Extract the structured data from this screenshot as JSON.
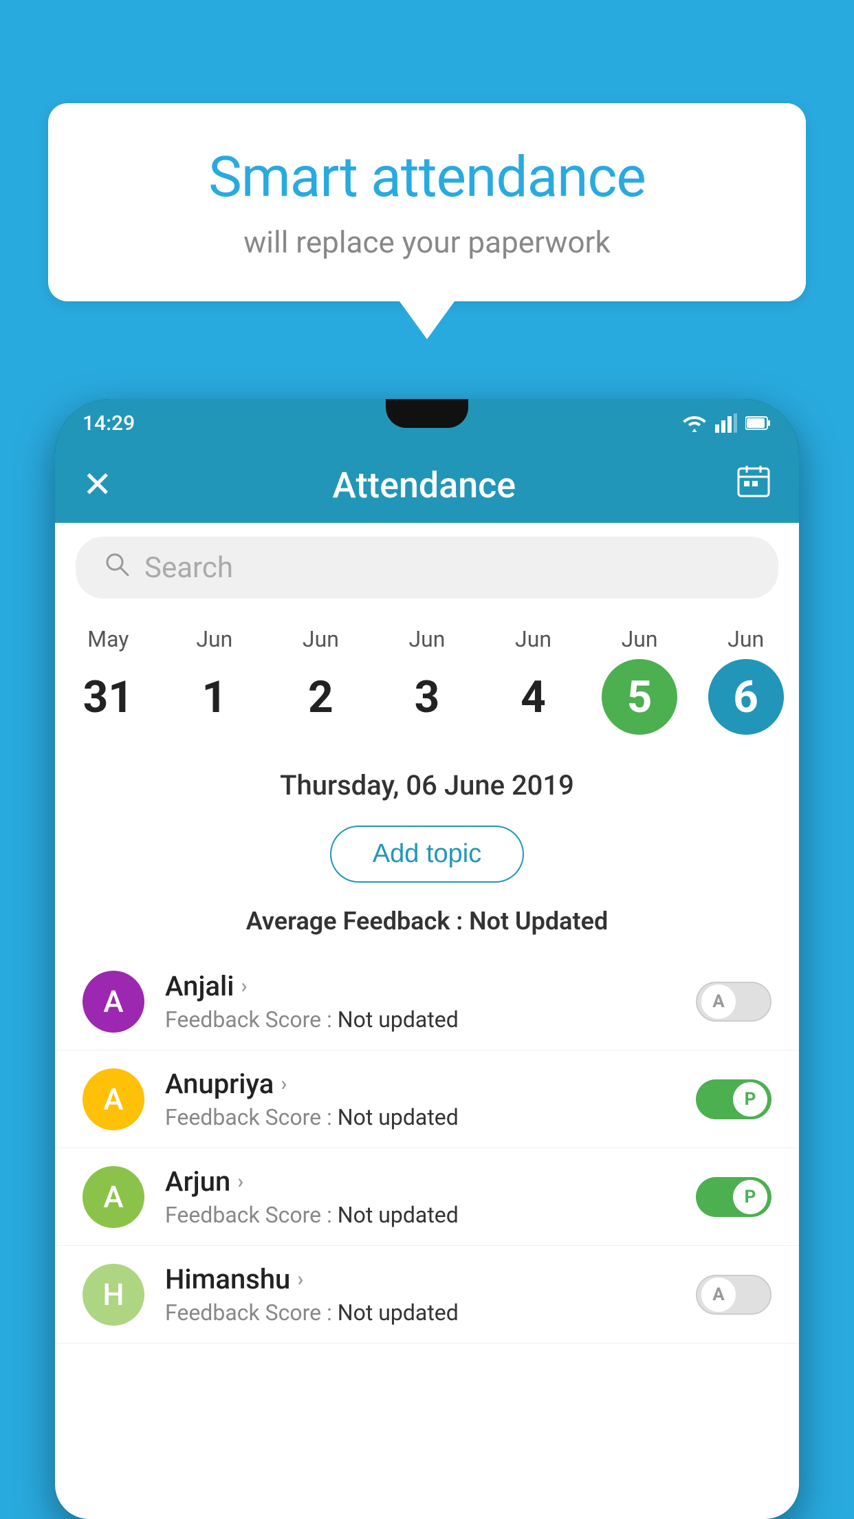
{
  "background_color": "#29AADF",
  "speech_bubble": {
    "title": "Smart attendance",
    "subtitle": "will replace your paperwork"
  },
  "status_bar": {
    "time": "14:29",
    "icons": [
      "wifi",
      "signal",
      "battery"
    ]
  },
  "app_bar": {
    "title": "Attendance",
    "close_label": "✕",
    "calendar_label": "📅"
  },
  "search": {
    "placeholder": "Search"
  },
  "calendar": {
    "days": [
      {
        "month": "May",
        "date": "31",
        "style": "normal"
      },
      {
        "month": "Jun",
        "date": "1",
        "style": "normal"
      },
      {
        "month": "Jun",
        "date": "2",
        "style": "normal"
      },
      {
        "month": "Jun",
        "date": "3",
        "style": "normal"
      },
      {
        "month": "Jun",
        "date": "4",
        "style": "normal"
      },
      {
        "month": "Jun",
        "date": "5",
        "style": "green"
      },
      {
        "month": "Jun",
        "date": "6",
        "style": "blue"
      }
    ],
    "selected_date": "Thursday, 06 June 2019"
  },
  "add_topic_label": "Add topic",
  "avg_feedback": {
    "label": "Average Feedback : ",
    "value": "Not Updated"
  },
  "students": [
    {
      "name": "Anjali",
      "avatar_letter": "A",
      "avatar_color": "#9C27B0",
      "feedback_label": "Feedback Score : ",
      "feedback_value": "Not updated",
      "toggle": "off",
      "toggle_letter": "A"
    },
    {
      "name": "Anupriya",
      "avatar_letter": "A",
      "avatar_color": "#FFC107",
      "feedback_label": "Feedback Score : ",
      "feedback_value": "Not updated",
      "toggle": "on",
      "toggle_letter": "P"
    },
    {
      "name": "Arjun",
      "avatar_letter": "A",
      "avatar_color": "#8BC34A",
      "feedback_label": "Feedback Score : ",
      "feedback_value": "Not updated",
      "toggle": "on",
      "toggle_letter": "P"
    },
    {
      "name": "Himanshu",
      "avatar_letter": "H",
      "avatar_color": "#AED581",
      "feedback_label": "Feedback Score : ",
      "feedback_value": "Not updated",
      "toggle": "off",
      "toggle_letter": "A"
    }
  ]
}
